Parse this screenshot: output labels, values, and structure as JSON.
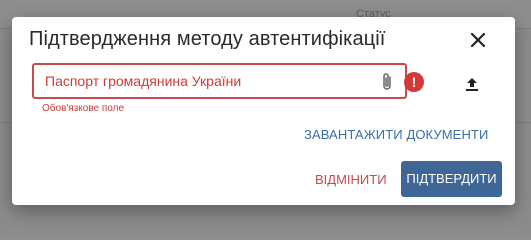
{
  "background": {
    "column_label": "Статус"
  },
  "dialog": {
    "title": "Підтвердження методу автентифікації",
    "field": {
      "value": "Паспорт громадянина України",
      "error_text": "Обов'язкове поле"
    },
    "upload_documents_label": "ЗАВАНТАЖИТИ ДОКУМЕНТИ",
    "cancel_label": "ВІДМІНИТИ",
    "confirm_label": "ПІДТВЕРДИТИ"
  },
  "icons": {
    "close": "close-icon",
    "attachment": "paperclip-icon",
    "error": "error-icon",
    "upload": "upload-icon"
  },
  "colors": {
    "error": "#c84a4a",
    "primary": "#3f6796",
    "link": "#3b6ea5"
  }
}
